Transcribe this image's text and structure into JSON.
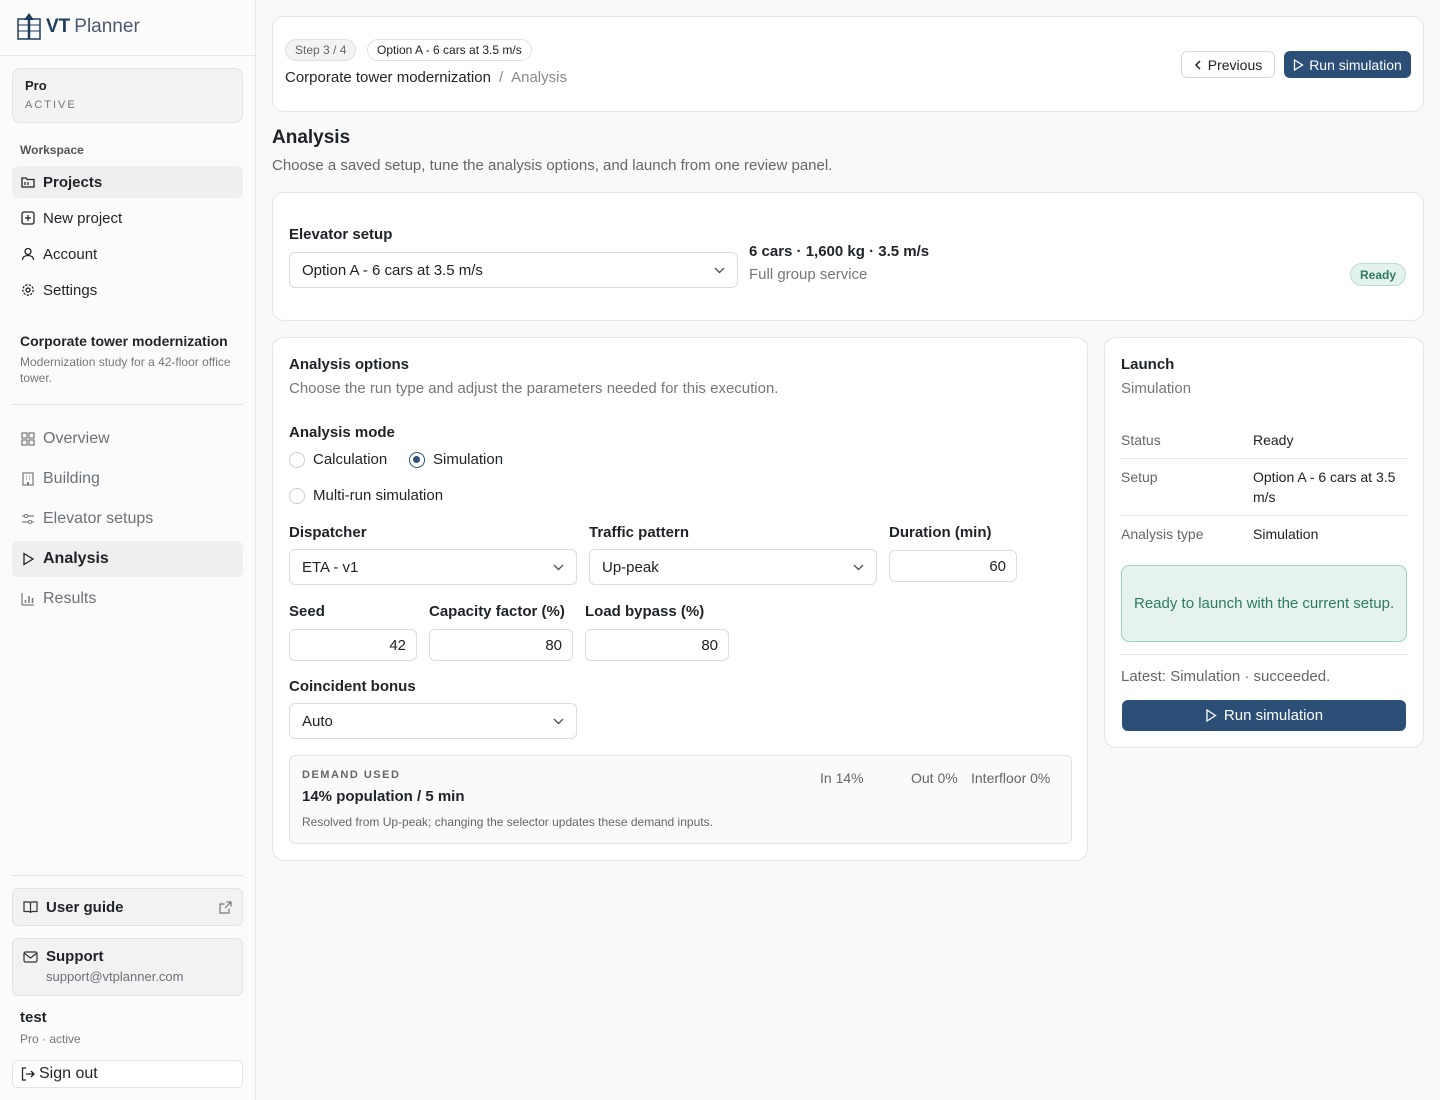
{
  "app": {
    "logo_primary": "VT",
    "logo_secondary": "Planner"
  },
  "plan": {
    "name": "Pro",
    "state": "ACTIVE"
  },
  "workspace": {
    "title": "Workspace",
    "items": [
      {
        "label": "Projects",
        "icon": "folder-icon"
      },
      {
        "label": "New project",
        "icon": "plus-square-icon"
      },
      {
        "label": "Account",
        "icon": "user-icon"
      },
      {
        "label": "Settings",
        "icon": "gear-icon"
      }
    ]
  },
  "project": {
    "title": "Corporate tower modernization",
    "description": "Modernization study for a 42-floor office tower."
  },
  "project_nav": [
    {
      "label": "Overview",
      "icon": "grid-icon"
    },
    {
      "label": "Building",
      "icon": "building-icon"
    },
    {
      "label": "Elevator setups",
      "icon": "sliders-icon"
    },
    {
      "label": "Analysis",
      "icon": "play-icon"
    },
    {
      "label": "Results",
      "icon": "bar-chart-icon"
    }
  ],
  "footer": {
    "guide": "User guide",
    "support_title": "Support",
    "support_email": "support@vtplanner.com",
    "user_name": "test",
    "user_plan": "Pro · active",
    "signout": "Sign out"
  },
  "topbar": {
    "step": "Step 3 / 4",
    "option": "Option A - 6 cars at 3.5 m/s",
    "crumb_project": "Corporate tower modernization",
    "crumb_sep": "/",
    "crumb_page": "Analysis",
    "previous": "Previous",
    "run": "Run simulation"
  },
  "page": {
    "title": "Analysis",
    "subtitle": "Choose a saved setup, tune the analysis options, and launch from one review panel."
  },
  "setup": {
    "label": "Elevator setup",
    "selected": "Option A - 6 cars at 3.5 m/s",
    "spec": "6 cars · 1,600 kg · 3.5 m/s",
    "service": "Full group service",
    "badge": "Ready"
  },
  "options": {
    "title": "Analysis options",
    "subtitle": "Choose the run type and adjust the parameters needed for this execution.",
    "mode_label": "Analysis mode",
    "modes": [
      "Calculation",
      "Simulation",
      "Multi-run simulation"
    ],
    "selected_mode": "Simulation",
    "dispatcher_label": "Dispatcher",
    "dispatcher": "ETA - v1",
    "traffic_label": "Traffic pattern",
    "traffic": "Up-peak",
    "duration_label": "Duration (min)",
    "duration": "60",
    "seed_label": "Seed",
    "seed": "42",
    "capacity_label": "Capacity factor (%)",
    "capacity": "80",
    "bypass_label": "Load bypass (%)",
    "bypass": "80",
    "bonus_label": "Coincident bonus",
    "bonus": "Auto"
  },
  "demand": {
    "caption": "DEMAND USED",
    "value": "14% population / 5 min",
    "note": "Resolved from Up-peak; changing the selector updates these demand inputs.",
    "in": "In 14%",
    "out": "Out 0%",
    "interfloor": "Interfloor 0%"
  },
  "launch": {
    "title": "Launch",
    "subtitle": "Simulation",
    "status_k": "Status",
    "status_v": "Ready",
    "setup_k": "Setup",
    "setup_v": "Option A - 6 cars at 3.5 m/s",
    "type_k": "Analysis type",
    "type_v": "Simulation",
    "ready_msg": "Ready to launch with the current setup.",
    "latest": "Latest: Simulation · succeeded.",
    "button": "Run simulation"
  },
  "colors": {
    "primary": "#2c4f78",
    "success": "#2f7a66"
  }
}
